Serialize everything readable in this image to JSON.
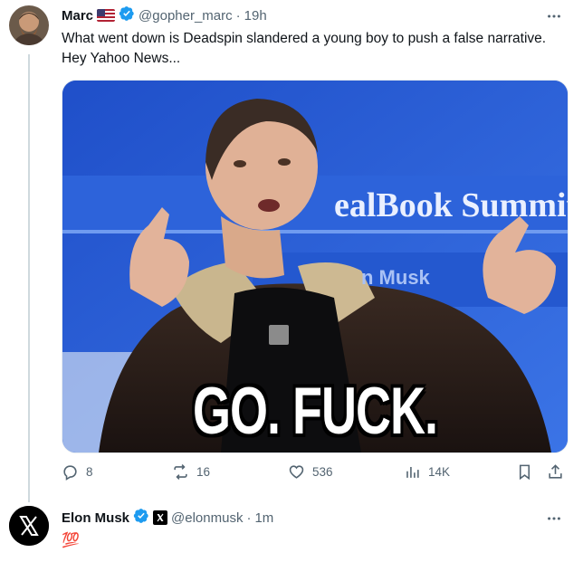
{
  "tweet1": {
    "display_name": "Marc",
    "handle": "@gopher_marc",
    "separator": "·",
    "time": "19h",
    "text": "What went down is Deadspin slandered a young boy to push a false narrative. Hey Yahoo News...",
    "media": {
      "backdrop_text": "ealBook Summit",
      "backdrop_sub": "n Musk",
      "caption": "GO. FUCK. YOURSELF."
    },
    "stats": {
      "replies": "8",
      "reposts": "16",
      "likes": "536",
      "views": "14K"
    }
  },
  "tweet2": {
    "display_name": "Elon Musk",
    "handle": "@elonmusk",
    "separator": "·",
    "time": "1m",
    "text": "💯"
  },
  "colors": {
    "verified_blue": "#1d9bf0",
    "muted_gray": "#536471",
    "line_gray": "#cfd9de",
    "stage_blue": "#2a5cd3"
  },
  "icons": [
    "more-icon",
    "verified-icon",
    "us-flag-icon",
    "reply-icon",
    "repost-icon",
    "like-icon",
    "views-icon",
    "bookmark-icon",
    "share-icon",
    "x-logo-icon",
    "hundred-points-emoji"
  ]
}
